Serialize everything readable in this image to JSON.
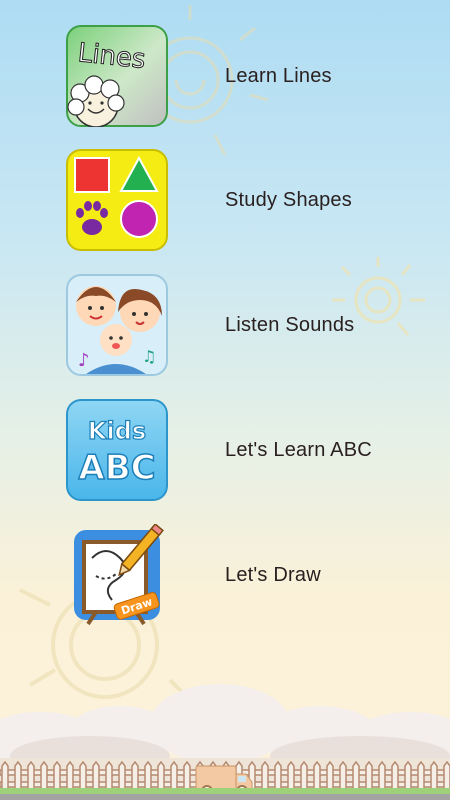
{
  "menu": {
    "items": [
      {
        "label": "Learn Lines",
        "icon": "lines-icon",
        "icon_text": "Lines"
      },
      {
        "label": "Study Shapes",
        "icon": "shapes-icon"
      },
      {
        "label": "Listen Sounds",
        "icon": "family-sounds-icon"
      },
      {
        "label": "Let's Learn ABC",
        "icon": "kids-abc-icon",
        "icon_text_top": "Kids",
        "icon_text_bottom": "ABC"
      },
      {
        "label": "Let's Draw",
        "icon": "drawing-easel-icon",
        "icon_text": "Draw"
      }
    ]
  },
  "colors": {
    "sky_top": "#aedcf3",
    "sky_bottom": "#fdf3dc",
    "label_text": "#2a2020"
  }
}
